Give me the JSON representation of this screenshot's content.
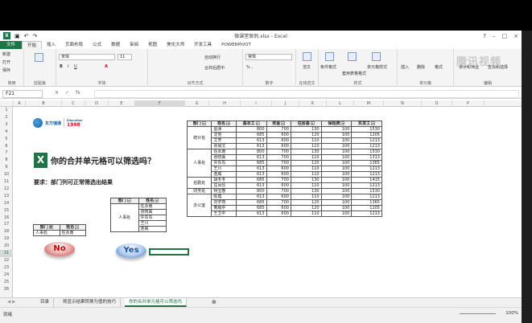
{
  "window": {
    "title": "微课堂案例.xlsx - Excel"
  },
  "tabs": [
    "文件",
    "开始",
    "插入",
    "页面布局",
    "公式",
    "数据",
    "审阅",
    "视图",
    "美化大师",
    "开发工具",
    "POWERPIVOT"
  ],
  "ribbon": {
    "clipboard": {
      "label": "剪贴板",
      "new": "新建",
      "open": "打开",
      "save": "保存",
      "recent": "常用"
    },
    "font": {
      "label": "字体",
      "name": "宋体",
      "size": "11"
    },
    "alignment": {
      "label": "对齐方式",
      "wrap": "自动换行",
      "merge": "合并后居中"
    },
    "number": {
      "label": "数字",
      "format": "常规"
    },
    "style": {
      "label": "在线范文",
      "a": "范文"
    },
    "styles": {
      "label": "样式",
      "cond": "条件格式",
      "table": "套用表格格式",
      "cell": "单元格样式"
    },
    "cells": {
      "label": "单元格",
      "insert": "插入",
      "delete": "删除",
      "format": "格式"
    },
    "editing": {
      "label": "编辑",
      "sort": "排序和筛选",
      "find": "查找和选择"
    },
    "watermark": "腾讯视频"
  },
  "formula_bar": {
    "name_box": "F21",
    "fx": "fx",
    "content": ""
  },
  "columns": [
    "A",
    "B",
    "C",
    "D",
    "E",
    "F",
    "G",
    "H",
    "I",
    "J",
    "K",
    "L",
    "M",
    "N",
    "O",
    "P"
  ],
  "rows": [
    "1",
    "2",
    "3",
    "4",
    "5",
    "6",
    "7",
    "8",
    "9",
    "10",
    "11",
    "12",
    "13",
    "14",
    "15",
    "16",
    "17",
    "18",
    "19",
    "20",
    "21",
    "22",
    "23",
    "24",
    "25",
    "26"
  ],
  "logo": {
    "name": "东方瑞通",
    "year": "1998",
    "since": "Education"
  },
  "heading": "你的合并单元格可以筛选吗？",
  "requirement": "要求：部门列可正常筛选出结果",
  "small_table": {
    "headers": [
      "部门",
      "姓名"
    ],
    "rows": [
      [
        "人事处",
        "任永南"
      ]
    ]
  },
  "mid_table": {
    "headers": [
      "部门",
      "姓名"
    ],
    "dept": "人事处",
    "names": [
      "任永南",
      "张晓菁",
      "许东东",
      "王川",
      "连威"
    ]
  },
  "main_table": {
    "headers": [
      "部门",
      "姓名",
      "基本工",
      "奖金",
      "住房基",
      "保险费",
      "实发工"
    ],
    "groups": [
      {
        "dept": "统计处",
        "rows": [
          [
            "葛洲",
            "800",
            "700",
            "130",
            "100",
            "1530"
          ],
          [
            "沈克",
            "685",
            "600",
            "120",
            "100",
            "1205"
          ],
          [
            "艾芳",
            "613",
            "600",
            "110",
            "100",
            "1213"
          ],
          [
            "张易文",
            "613",
            "600",
            "110",
            "100",
            "1213"
          ]
        ]
      },
      {
        "dept": "人事处",
        "rows": [
          [
            "任永南",
            "800",
            "700",
            "130",
            "100",
            "1530"
          ],
          [
            "张晓菁",
            "613",
            "700",
            "110",
            "100",
            "1313"
          ],
          [
            "许东东",
            "685",
            "700",
            "120",
            "100",
            "1365"
          ],
          [
            "王川",
            "613",
            "600",
            "110",
            "100",
            "1213"
          ],
          [
            "连威",
            "613",
            "600",
            "110",
            "100",
            "1213"
          ]
        ]
      },
      {
        "dept": "后勤处",
        "rows": [
          [
            "胡冬冬",
            "685",
            "700",
            "130",
            "100",
            "1415"
          ],
          [
            "庄凤仪",
            "613",
            "600",
            "110",
            "100",
            "1213"
          ]
        ]
      },
      {
        "dept": "财务处",
        "rows": [
          [
            "杨宝春",
            "800",
            "700",
            "130",
            "100",
            "1530"
          ]
        ]
      },
      {
        "dept": "办公室",
        "rows": [
          [
            "陈霞",
            "613",
            "600",
            "110",
            "100",
            "1213"
          ],
          [
            "刘学燕",
            "685",
            "700",
            "120",
            "100",
            "1365"
          ],
          [
            "黄威中",
            "685",
            "600",
            "120",
            "100",
            "1205"
          ],
          [
            "王卫平",
            "613",
            "600",
            "110",
            "100",
            "1213"
          ]
        ]
      }
    ]
  },
  "buttons": {
    "no": "No",
    "yes": "Yes"
  },
  "sheet_tabs": [
    "目录",
    "将显示结果转换为值的技巧",
    "你的合并单元格可以筛选吗"
  ],
  "status": {
    "ready": "就绪",
    "zoom": "100%"
  }
}
